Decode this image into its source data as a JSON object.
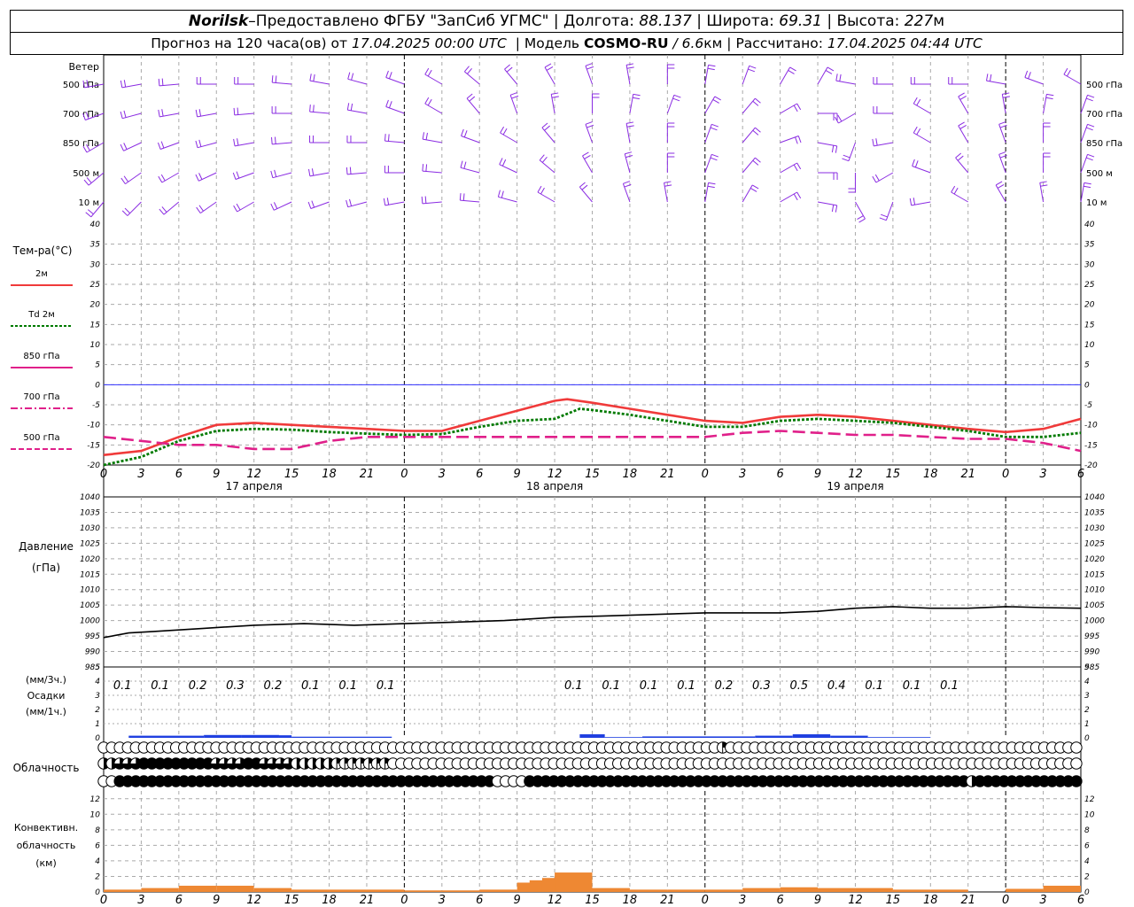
{
  "header": {
    "station": "Norilsk",
    "dash": " – ",
    "provider": "Предоставлено ФГБУ \"ЗапСиб УГМС\"",
    "lon_label": "Долгота:",
    "lon_value": "88.137",
    "lat_label": "Широта:",
    "lat_value": "69.31",
    "alt_label": "Высота:",
    "alt_value": "227",
    "alt_unit": "м",
    "forecast_prefix": "Прогноз на 120 часа(ов) от",
    "forecast_start": "17.04.2025 00:00 UTC",
    "model_label": "| Модель",
    "model_name": "COSMO-RU",
    "model_res": "/ 6.6",
    "model_res_unit": "км",
    "calc_label": "| Рассчитано:",
    "calc_time": "17.04.2025 04:44 UTC"
  },
  "colors": {
    "wind": "#8a2be2",
    "t2m": "#f03a3a",
    "td2m": "#007a00",
    "t850": "#e0208a",
    "t700": "#e0208a",
    "t500": "#e0208a",
    "pressure": "#000000",
    "precip": "#2040e0",
    "convective": "#ee8833",
    "zero_line": "#3030ff"
  },
  "x_ticks": [
    "0",
    "3",
    "6",
    "9",
    "12",
    "15",
    "18",
    "21",
    "0",
    "3",
    "6",
    "9",
    "12",
    "15",
    "18",
    "21",
    "0",
    "3",
    "6",
    "9",
    "12",
    "15",
    "18",
    "21",
    "0",
    "3",
    "6"
  ],
  "dates": [
    "17 апреля",
    "18 апреля",
    "19 апреля"
  ],
  "chart_data": [
    {
      "type": "barbs",
      "title": "Ветер",
      "levels": [
        "500 гПа",
        "700 гПа",
        "850 гПа",
        "500 м",
        "10 м"
      ],
      "x_hours": [
        0,
        78
      ],
      "direction_deg": {
        "500 гПа": [
          260,
          260,
          265,
          270,
          270,
          275,
          280,
          285,
          290,
          300,
          310,
          320,
          330,
          340,
          350,
          0,
          10,
          20,
          30,
          30,
          280,
          270,
          270,
          270,
          280,
          290,
          300
        ],
        "700 гПа": [
          250,
          255,
          260,
          260,
          265,
          270,
          275,
          280,
          290,
          300,
          320,
          340,
          350,
          0,
          10,
          20,
          30,
          40,
          60,
          90,
          240,
          270,
          300,
          330,
          350,
          10,
          20
        ],
        "850 гПа": [
          240,
          245,
          250,
          255,
          260,
          265,
          270,
          270,
          275,
          280,
          290,
          300,
          320,
          340,
          350,
          0,
          20,
          40,
          70,
          100,
          200,
          260,
          300,
          330,
          340,
          0,
          20
        ],
        "500 м": [
          230,
          235,
          240,
          245,
          250,
          255,
          260,
          265,
          270,
          275,
          285,
          295,
          310,
          330,
          345,
          0,
          20,
          40,
          60,
          90,
          180,
          240,
          290,
          320,
          340,
          0,
          20
        ],
        "10 м": [
          220,
          225,
          230,
          235,
          240,
          245,
          250,
          255,
          260,
          265,
          275,
          285,
          300,
          320,
          340,
          350,
          10,
          30,
          60,
          100,
          150,
          200,
          260,
          300,
          330,
          350,
          10
        ]
      }
    },
    {
      "type": "line",
      "ylabel": "Тем-ра(°С)",
      "ylim": [
        -20,
        40
      ],
      "yticks": [
        -20,
        -15,
        -10,
        -5,
        0,
        5,
        10,
        15,
        20,
        25,
        30,
        35,
        40
      ],
      "series": [
        {
          "name": "2м",
          "x": [
            0,
            3,
            6,
            9,
            12,
            15,
            18,
            21,
            24,
            27,
            30,
            33,
            36,
            37,
            39,
            42,
            45,
            48,
            51,
            54,
            57,
            60,
            63,
            66,
            69,
            72,
            75,
            78
          ],
          "values": [
            -17.5,
            -16.5,
            -13,
            -10,
            -9.5,
            -10,
            -10.5,
            -11,
            -11.5,
            -11.5,
            -9,
            -6.5,
            -4,
            -3.6,
            -4.5,
            -6,
            -7.5,
            -9,
            -9.5,
            -8,
            -7.5,
            -8,
            -9,
            -10,
            -11,
            -11.8,
            -11,
            -8.5
          ]
        },
        {
          "name": "Td 2м",
          "x": [
            0,
            3,
            6,
            9,
            12,
            15,
            18,
            21,
            24,
            27,
            30,
            33,
            36,
            38,
            39,
            42,
            45,
            48,
            51,
            54,
            57,
            60,
            63,
            66,
            69,
            72,
            75,
            78
          ],
          "values": [
            -20,
            -18,
            -14,
            -11.5,
            -11,
            -11.2,
            -11.8,
            -12.2,
            -12.5,
            -12.3,
            -10.5,
            -9,
            -8.5,
            -6,
            -6.3,
            -7.5,
            -9,
            -10.5,
            -10.5,
            -9,
            -8.5,
            -9,
            -9.5,
            -10.5,
            -11.5,
            -13,
            -13,
            -12
          ]
        },
        {
          "name": "850 гПа",
          "x": [
            0,
            3,
            6,
            9,
            12,
            15,
            18,
            21,
            24,
            27,
            30,
            33,
            36,
            39,
            42,
            45,
            48,
            51,
            54,
            57,
            60,
            63,
            66,
            69,
            72,
            75,
            78
          ],
          "values": [
            -13,
            -14,
            -15,
            -15,
            -16,
            -16,
            -14,
            -13,
            -13,
            -13,
            -13,
            -13,
            -13,
            -13,
            -13,
            -13,
            -13,
            -12,
            -11.5,
            -12,
            -12.5,
            -12.5,
            -13,
            -13.5,
            -13.5,
            -14.5,
            -16.5
          ]
        }
      ],
      "legend": [
        "2м",
        "Td 2м",
        "850 гПа",
        "700 гПа",
        "500 гПа"
      ]
    },
    {
      "type": "line",
      "ylabel": "Давление (гПа)",
      "ylim": [
        985,
        1040
      ],
      "yticks": [
        985,
        990,
        995,
        1000,
        1005,
        1010,
        1015,
        1020,
        1025,
        1030,
        1035,
        1040
      ],
      "series": [
        {
          "name": "Давление",
          "x": [
            0,
            2,
            4,
            8,
            12,
            16,
            20,
            24,
            28,
            32,
            36,
            40,
            44,
            48,
            51,
            54,
            57,
            60,
            63,
            66,
            69,
            72,
            75,
            78
          ],
          "values": [
            994.5,
            996,
            996.5,
            997.5,
            998.5,
            999,
            998.5,
            999,
            999.5,
            1000,
            1001,
            1001.5,
            1002,
            1002.5,
            1002.5,
            1002.5,
            1003,
            1004,
            1004.5,
            1004,
            1004,
            1004.5,
            1004.2,
            1004
          ]
        }
      ]
    },
    {
      "type": "bar",
      "ylabel": "Осадки",
      "units_top": "(мм/3ч.)",
      "units_bottom": "(мм/1ч.)",
      "ylim": [
        0,
        5
      ],
      "yticks": [
        0,
        1,
        2,
        3,
        4,
        5
      ],
      "labels_3h": [
        {
          "x": 1.5,
          "text": "0.1"
        },
        {
          "x": 4.5,
          "text": "0.1"
        },
        {
          "x": 7.5,
          "text": "0.2"
        },
        {
          "x": 10.5,
          "text": "0.3"
        },
        {
          "x": 13.5,
          "text": "0.2"
        },
        {
          "x": 16.5,
          "text": "0.1"
        },
        {
          "x": 19.5,
          "text": "0.1"
        },
        {
          "x": 22.5,
          "text": "0.1"
        },
        {
          "x": 37.5,
          "text": "0.1"
        },
        {
          "x": 40.5,
          "text": "0.1"
        },
        {
          "x": 43.5,
          "text": "0.1"
        },
        {
          "x": 46.5,
          "text": "0.1"
        },
        {
          "x": 49.5,
          "text": "0.2"
        },
        {
          "x": 52.5,
          "text": "0.3"
        },
        {
          "x": 55.5,
          "text": "0.5"
        },
        {
          "x": 58.5,
          "text": "0.4"
        },
        {
          "x": 61.5,
          "text": "0.1"
        },
        {
          "x": 64.5,
          "text": "0.1"
        },
        {
          "x": 67.5,
          "text": "0.1"
        }
      ],
      "hourly": [
        {
          "x0": 2,
          "x1": 8,
          "v": 0.15
        },
        {
          "x0": 8,
          "x1": 11,
          "v": 0.2
        },
        {
          "x0": 11,
          "x1": 14,
          "v": 0.2
        },
        {
          "x0": 14,
          "x1": 15,
          "v": 0.18
        },
        {
          "x0": 15,
          "x1": 23,
          "v": 0.08
        },
        {
          "x0": 38,
          "x1": 40,
          "v": 0.25
        },
        {
          "x0": 40,
          "x1": 43,
          "v": 0.05
        },
        {
          "x0": 43,
          "x1": 52,
          "v": 0.1
        },
        {
          "x0": 52,
          "x1": 55,
          "v": 0.15
        },
        {
          "x0": 55,
          "x1": 58,
          "v": 0.25
        },
        {
          "x0": 58,
          "x1": 61,
          "v": 0.15
        },
        {
          "x0": 61,
          "x1": 66,
          "v": 0.05
        }
      ]
    },
    {
      "type": "table",
      "title": "Облачность",
      "rows": [
        "upper",
        "middle",
        "lower"
      ],
      "cover_octas": {
        "upper": [
          0,
          0,
          0,
          0,
          0,
          0,
          0,
          0,
          0,
          0,
          0,
          0,
          0,
          0,
          0,
          0,
          0,
          0,
          0,
          0,
          0,
          0,
          0,
          0,
          0,
          0,
          0,
          0,
          0,
          0,
          0,
          0,
          0,
          0,
          0,
          0,
          0,
          0,
          0,
          0,
          0,
          0,
          0,
          0,
          0,
          0,
          0,
          0,
          0,
          0,
          0,
          0,
          0,
          0,
          0,
          0,
          0,
          0,
          0,
          0,
          0,
          0,
          0,
          0,
          0,
          0,
          0,
          0,
          0,
          0,
          0,
          0,
          0,
          0,
          0,
          0,
          0,
          2,
          0,
          0,
          0,
          0,
          0,
          0,
          0,
          0,
          0,
          0,
          0,
          0,
          0,
          0,
          0,
          0,
          0,
          0,
          0,
          0,
          0,
          0,
          0,
          0,
          0,
          0,
          0,
          0,
          0,
          0,
          0,
          0,
          0,
          0,
          0,
          0,
          0,
          0,
          0,
          0,
          0,
          0,
          0,
          0
        ],
        "middle": [
          4,
          4,
          6,
          6,
          6,
          8,
          8,
          8,
          8,
          8,
          8,
          8,
          8,
          8,
          6,
          6,
          6,
          6,
          8,
          8,
          6,
          6,
          6,
          6,
          4,
          4,
          4,
          4,
          4,
          2,
          2,
          2,
          2,
          2,
          2,
          2,
          0,
          0,
          0,
          0,
          0,
          0,
          0,
          0,
          0,
          0,
          0,
          0,
          0,
          0,
          0,
          0,
          0,
          0,
          0,
          0,
          0,
          0,
          0,
          0,
          0,
          0,
          0,
          0,
          0,
          0,
          0,
          0,
          0,
          0,
          0,
          0,
          0,
          0,
          0,
          0,
          0,
          0,
          0,
          0,
          0,
          0,
          0,
          0,
          0,
          0,
          0,
          0,
          0,
          0,
          0,
          0,
          0,
          0,
          0,
          0,
          0,
          0,
          0,
          0,
          0,
          0,
          0,
          0,
          0,
          0,
          0,
          0,
          0,
          0,
          0,
          0,
          0,
          0,
          0,
          0,
          0,
          0,
          0,
          0,
          0,
          0
        ],
        "lower": [
          0,
          0,
          8,
          8,
          8,
          8,
          8,
          8,
          8,
          8,
          8,
          8,
          8,
          8,
          8,
          8,
          8,
          8,
          8,
          8,
          8,
          8,
          8,
          8,
          8,
          8,
          8,
          8,
          8,
          8,
          8,
          8,
          8,
          8,
          8,
          8,
          8,
          8,
          8,
          8,
          8,
          8,
          8,
          8,
          8,
          8,
          8,
          8,
          8,
          0,
          0,
          0,
          0,
          8,
          8,
          8,
          8,
          8,
          8,
          8,
          8,
          8,
          8,
          8,
          8,
          8,
          8,
          8,
          8,
          8,
          8,
          8,
          8,
          8,
          8,
          8,
          8,
          8,
          8,
          8,
          8,
          8,
          8,
          8,
          8,
          8,
          8,
          8,
          8,
          8,
          8,
          8,
          8,
          8,
          8,
          8,
          8,
          8,
          8,
          8,
          8,
          8,
          8,
          8,
          8,
          8,
          8,
          8,
          4,
          8,
          8,
          8,
          8,
          8,
          8,
          8,
          8,
          8,
          8,
          8,
          8,
          8
        ]
      }
    },
    {
      "type": "bar",
      "ylabel": "Конвективн. облачность (км)",
      "ylim": [
        0,
        13
      ],
      "yticks": [
        0,
        2,
        4,
        6,
        8,
        10,
        12
      ],
      "x": [
        1.5,
        4.5,
        7.5,
        10.5,
        13.5,
        16.5,
        19.5,
        22.5,
        25.5,
        28.5,
        31.5,
        34.5,
        35.5,
        36.5,
        37.5,
        40.5,
        43.5,
        46.5,
        49.5,
        52.5,
        55.5,
        58.5,
        61.5,
        64.5,
        67.5,
        70.5,
        73.5,
        76.5
      ],
      "values": [
        0.3,
        0.5,
        0.8,
        0.8,
        0.5,
        0.3,
        0.3,
        0.3,
        0.2,
        0.2,
        0.3,
        1.2,
        1.5,
        1.8,
        2.5,
        0.5,
        0.3,
        0.3,
        0.3,
        0.5,
        0.6,
        0.5,
        0.5,
        0.3,
        0.3,
        0,
        0.4,
        0.8
      ]
    }
  ]
}
